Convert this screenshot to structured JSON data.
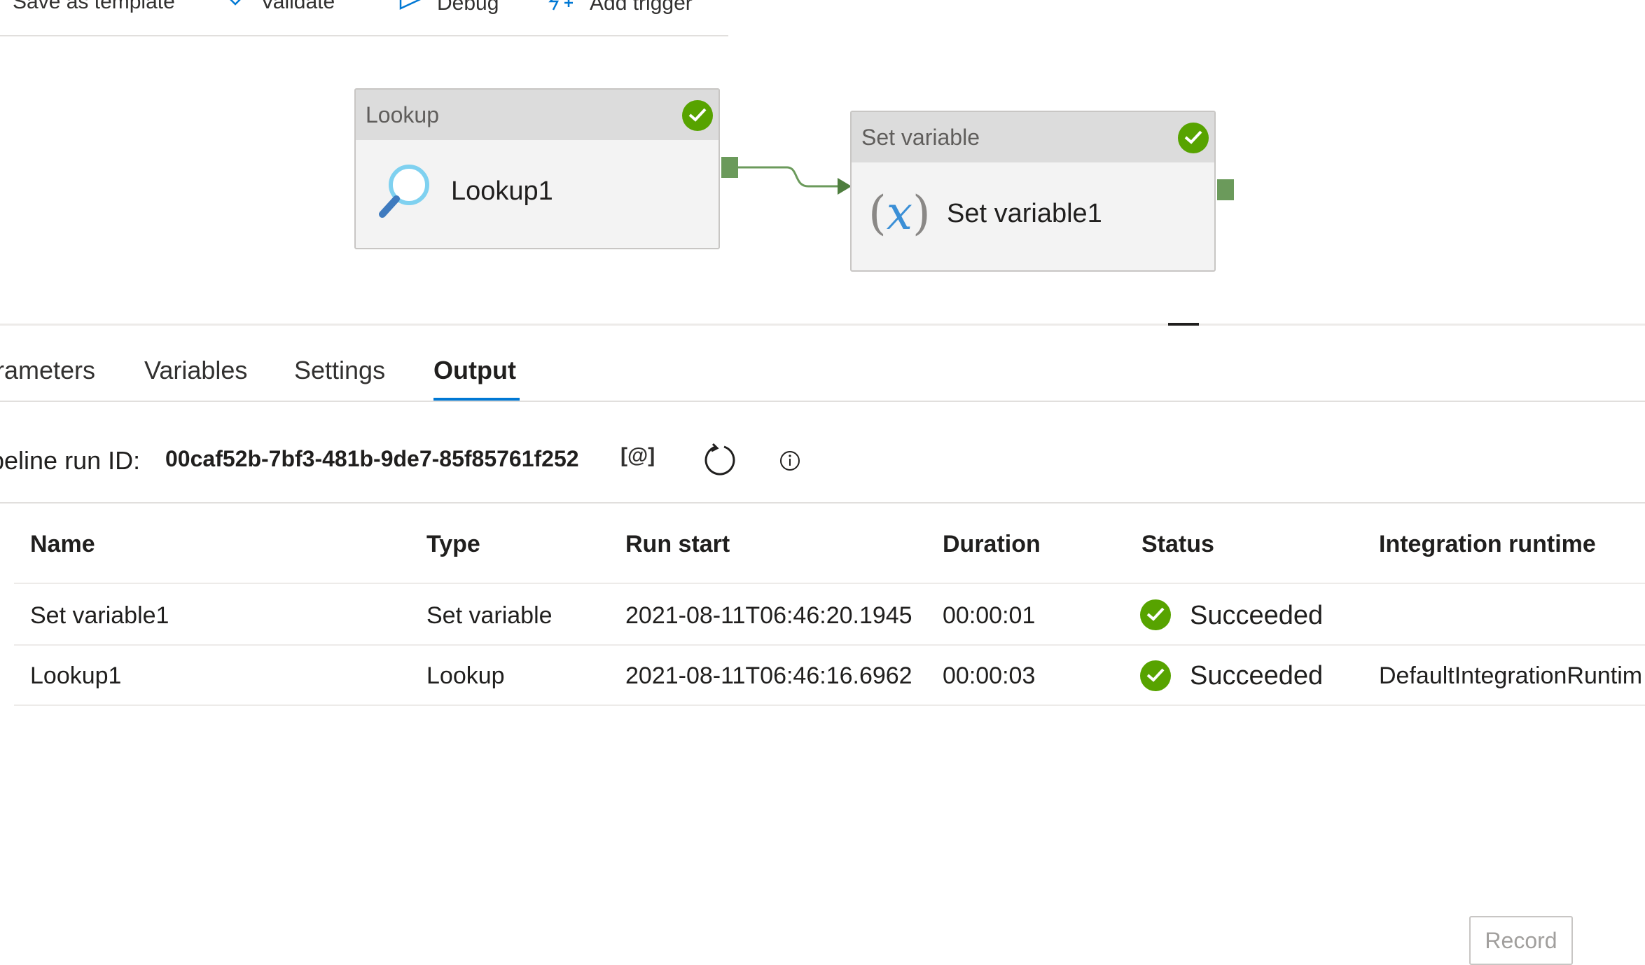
{
  "toolbar": {
    "items": [
      {
        "label": "Save as template",
        "icon": "save-template-icon"
      },
      {
        "label": "Validate",
        "icon": "checkmark-icon"
      },
      {
        "label": "Debug",
        "icon": "play-icon"
      },
      {
        "label": "Add trigger",
        "icon": "trigger-icon"
      }
    ]
  },
  "pipeline": {
    "activities": [
      {
        "type": "Lookup",
        "name": "Lookup1",
        "icon": "search-icon",
        "status": "succeeded"
      },
      {
        "type": "Set variable",
        "name": "Set variable1",
        "icon": "variable-icon",
        "icon_text": "(x)",
        "status": "succeeded"
      }
    ]
  },
  "tabs": [
    {
      "label": "rameters"
    },
    {
      "label": "Variables"
    },
    {
      "label": "Settings"
    },
    {
      "label": "Output",
      "active": true
    }
  ],
  "output": {
    "run_id_label": "peline run ID:",
    "run_id": "00caf52b-7bf3-481b-9de7-85f85761f252",
    "copy_icon_text": "[@]",
    "columns": [
      "Name",
      "Type",
      "Run start",
      "Duration",
      "Status",
      "Integration runtime"
    ],
    "rows": [
      {
        "name": "Set variable1",
        "type": "Set variable",
        "run_start": "2021-08-11T06:46:20.1945",
        "duration": "00:00:01",
        "status": "Succeeded",
        "runtime": ""
      },
      {
        "name": "Lookup1",
        "type": "Lookup",
        "run_start": "2021-08-11T06:46:16.6962",
        "duration": "00:00:03",
        "status": "Succeeded",
        "runtime": "DefaultIntegrationRuntim"
      }
    ]
  },
  "record_button": "Record",
  "colors": {
    "success": "#57a300",
    "accent": "#0078d4",
    "port": "#6b9a5b"
  }
}
